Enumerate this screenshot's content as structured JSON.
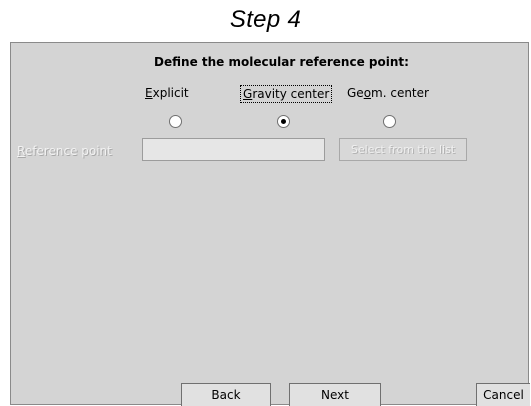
{
  "step_title": "Step 4",
  "heading": "Define the molecular reference point:",
  "options": [
    {
      "label_pre": "",
      "label_ul": "E",
      "label_post": "xplicit",
      "selected": false
    },
    {
      "label_pre": "",
      "label_ul": "G",
      "label_post": "ravity center",
      "selected": true
    },
    {
      "label_pre": "Ge",
      "label_ul": "o",
      "label_post": "m. center",
      "selected": false
    }
  ],
  "reference_point": {
    "label_ul": "R",
    "label_post": "eference point",
    "value": ""
  },
  "select_button": "Select from the list",
  "buttons": {
    "back": "Back",
    "next": "Next",
    "cancel": "Cancel"
  }
}
